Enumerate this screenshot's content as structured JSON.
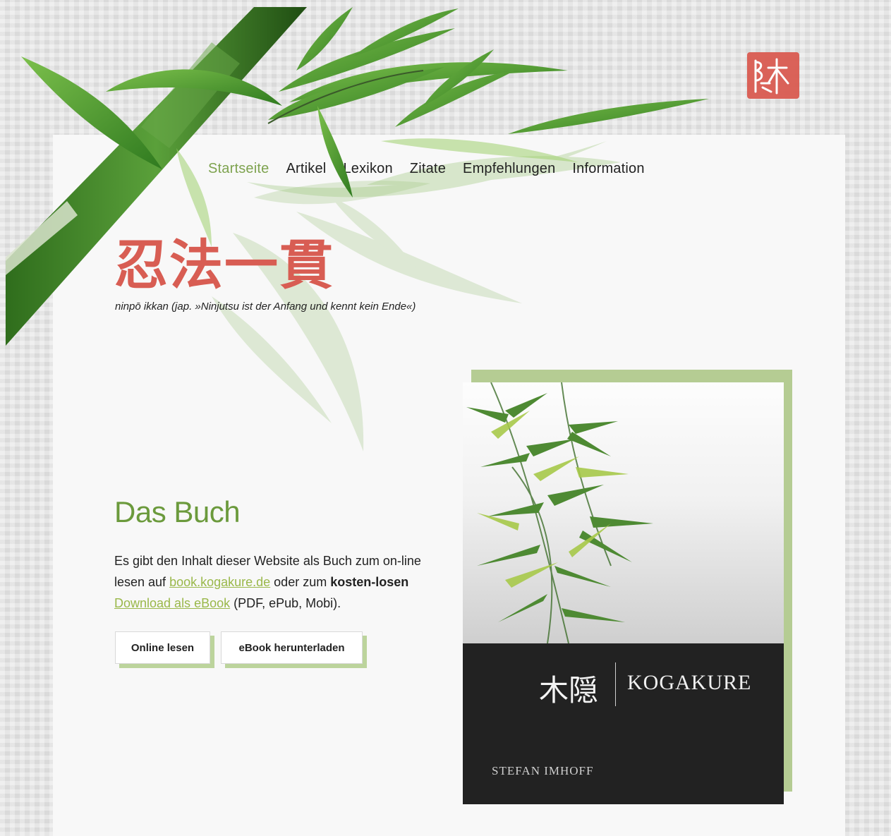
{
  "nav": {
    "items": [
      {
        "label": "Startseite",
        "active": true
      },
      {
        "label": "Artikel"
      },
      {
        "label": "Lexikon"
      },
      {
        "label": "Zitate"
      },
      {
        "label": "Empfehlungen"
      },
      {
        "label": "Information"
      }
    ]
  },
  "hero": {
    "kanji": "忍法一貫",
    "subtitle": "ninpō ikkan (jap. »Ninjutsu ist der Anfang und kennt kein Ende«)"
  },
  "book": {
    "heading": "Das Buch",
    "text_1": "Es gibt den Inhalt dieser Website als Buch zum on-line lesen auf ",
    "link_1": "book.kogakure.de",
    "text_2": " oder zum ",
    "bold": "kosten-losen",
    "text_3": " ",
    "link_2": "Download als eBook",
    "text_4": " (PDF, ePub, Mobi).",
    "button_online": "Online lesen",
    "button_ebook": "eBook herunterladen"
  },
  "cover": {
    "kanji": "木隠",
    "title": "KOGAKURE",
    "author": "STEFAN IMHOFF"
  },
  "colors": {
    "accent_green": "#7ea34f",
    "heading_green": "#6b9a3c",
    "kanji_red": "#d85d53",
    "button_shadow": "#bcd49c",
    "seal_red": "#d9574d"
  },
  "icons": {
    "logo": "kogakure-seal-icon"
  }
}
